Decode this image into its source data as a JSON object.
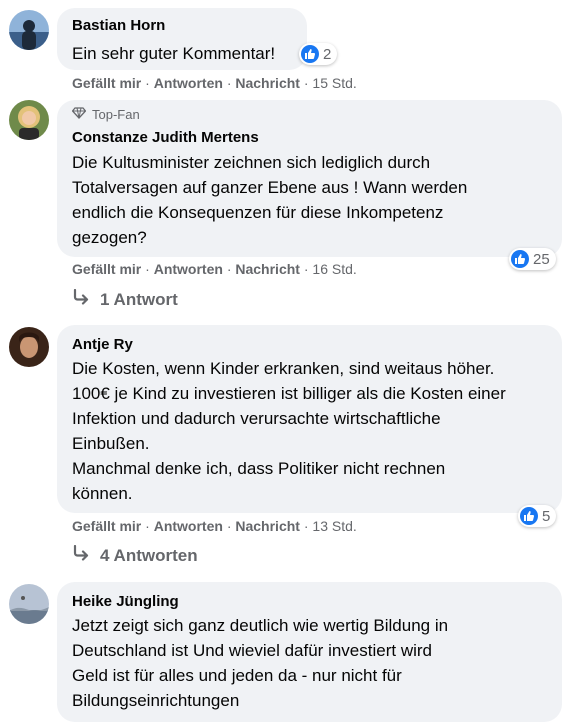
{
  "comments": [
    {
      "author": "Bastian Horn",
      "text": "Ein sehr guter Kommentar!",
      "likes": "2",
      "actions": {
        "like": "Gefällt mir",
        "reply": "Antworten",
        "message": "Nachricht",
        "time": "15 Std."
      }
    },
    {
      "badge": "Top-Fan",
      "author": "Constanze Judith Mertens",
      "lines": [
        "Die Kultusminister zeichnen sich lediglich durch",
        "Totalversagen auf ganzer Ebene aus ! Wann werden",
        "endlich die Konsequenzen für diese Inkompetenz",
        "gezogen?"
      ],
      "likes": "25",
      "actions": {
        "like": "Gefällt mir",
        "reply": "Antworten",
        "message": "Nachricht",
        "time": "16 Std."
      },
      "replies": "1 Antwort"
    },
    {
      "author": "Antje Ry",
      "lines": [
        "Die Kosten, wenn Kinder erkranken, sind weitaus höher.",
        "100€ je Kind zu investieren ist billiger als die Kosten einer",
        "Infektion und dadurch verursachte wirtschaftliche",
        "Einbußen.",
        "Manchmal denke ich, dass Politiker nicht rechnen",
        "können."
      ],
      "likes": "5",
      "actions": {
        "like": "Gefällt mir",
        "reply": "Antworten",
        "message": "Nachricht",
        "time": "13 Std."
      },
      "replies": "4 Antworten"
    },
    {
      "author": "Heike Jüngling",
      "lines": [
        "Jetzt zeigt sich ganz deutlich wie wertig Bildung in",
        "Deutschland ist Und wieviel dafür investiert wird",
        "Geld ist für alles und jeden da - nur nicht für",
        "Bildungseinrichtungen"
      ]
    }
  ],
  "separator": "·",
  "colors": {
    "like_blue": "#1877f2",
    "bubble": "#f0f2f5",
    "meta": "#65676b"
  }
}
